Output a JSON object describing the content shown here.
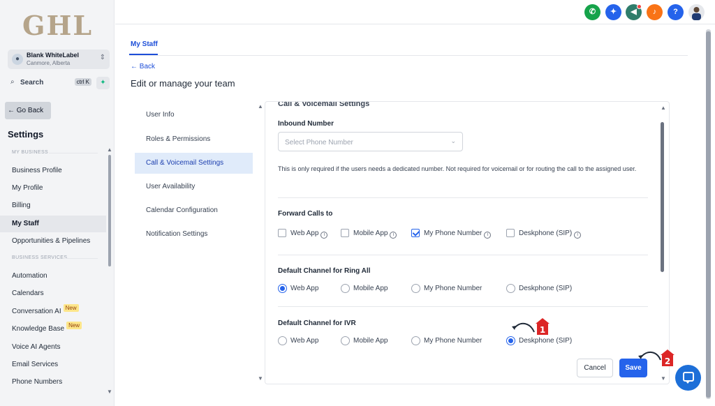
{
  "brand": {
    "logo_text": "GHL"
  },
  "account": {
    "name": "Blank WhiteLabel",
    "location": "Canmore, Alberta",
    "avatar_icon": "user-icon",
    "switch_icon": "chevron-updown-icon"
  },
  "search": {
    "label": "Search",
    "shortcut": "ctrl K",
    "ai_icon": "sparkle-icon"
  },
  "sidebar": {
    "go_back": "Go Back",
    "title": "Settings",
    "section_my_business": "MY BUSINESS",
    "section_business_services": "BUSINESS SERVICES",
    "items_business": [
      {
        "label": "Business Profile"
      },
      {
        "label": "My Profile"
      },
      {
        "label": "Billing"
      },
      {
        "label": "My Staff",
        "active": true
      },
      {
        "label": "Opportunities & Pipelines"
      }
    ],
    "items_services": [
      {
        "label": "Automation"
      },
      {
        "label": "Calendars"
      },
      {
        "label": "Conversation AI",
        "badge": "New"
      },
      {
        "label": "Knowledge Base",
        "badge": "New"
      },
      {
        "label": "Voice AI Agents"
      },
      {
        "label": "Email Services"
      },
      {
        "label": "Phone Numbers"
      }
    ]
  },
  "topbar": {
    "icons": [
      {
        "name": "phone-icon",
        "glyph": "✆",
        "color": "#16a34a"
      },
      {
        "name": "launchpad-icon",
        "glyph": "✦",
        "color": "#2563eb"
      },
      {
        "name": "megaphone-icon",
        "glyph": "◀",
        "color": "#2f7d6b"
      },
      {
        "name": "bell-icon",
        "glyph": "♪",
        "color": "#f97316"
      },
      {
        "name": "help-icon",
        "glyph": "?",
        "color": "#2563eb"
      }
    ]
  },
  "main": {
    "tab": "My Staff",
    "back": "← Back",
    "title": "Edit or manage your team",
    "subnav": [
      {
        "label": "User Info"
      },
      {
        "label": "Roles & Permissions"
      },
      {
        "label": "Call & Voicemail Settings",
        "active": true
      },
      {
        "label": "User Availability"
      },
      {
        "label": "Calendar Configuration"
      },
      {
        "label": "Notification Settings"
      }
    ]
  },
  "panel": {
    "heading": "Call & Voicemail Settings",
    "inbound_label": "Inbound Number",
    "inbound_placeholder": "Select Phone Number",
    "inbound_help": "This is only required if the users needs a dedicated number. Not required for voicemail or for routing the call to the assigned user.",
    "forward_label": "Forward Calls to",
    "forward_options": [
      {
        "label": "Web App",
        "checked": false
      },
      {
        "label": "Mobile App",
        "checked": false
      },
      {
        "label": "My Phone Number",
        "checked": true
      },
      {
        "label": "Deskphone (SIP)",
        "checked": false
      }
    ],
    "ring_all_label": "Default Channel for Ring All",
    "ring_all_options": [
      {
        "label": "Web App",
        "selected": true
      },
      {
        "label": "Mobile App",
        "selected": false
      },
      {
        "label": "My Phone Number",
        "selected": false
      },
      {
        "label": "Deskphone (SIP)",
        "selected": false
      }
    ],
    "ivr_label": "Default Channel for IVR",
    "ivr_options": [
      {
        "label": "Web App",
        "selected": false
      },
      {
        "label": "Mobile App",
        "selected": false
      },
      {
        "label": "My Phone Number",
        "selected": false
      },
      {
        "label": "Deskphone (SIP)",
        "selected": true
      }
    ]
  },
  "actions": {
    "cancel": "Cancel",
    "save": "Save"
  },
  "annotations": {
    "step1": "1",
    "step2": "2",
    "color": "#dc2626"
  },
  "colors": {
    "accent": "#2563eb",
    "active_bg": "#e0ebfa"
  }
}
